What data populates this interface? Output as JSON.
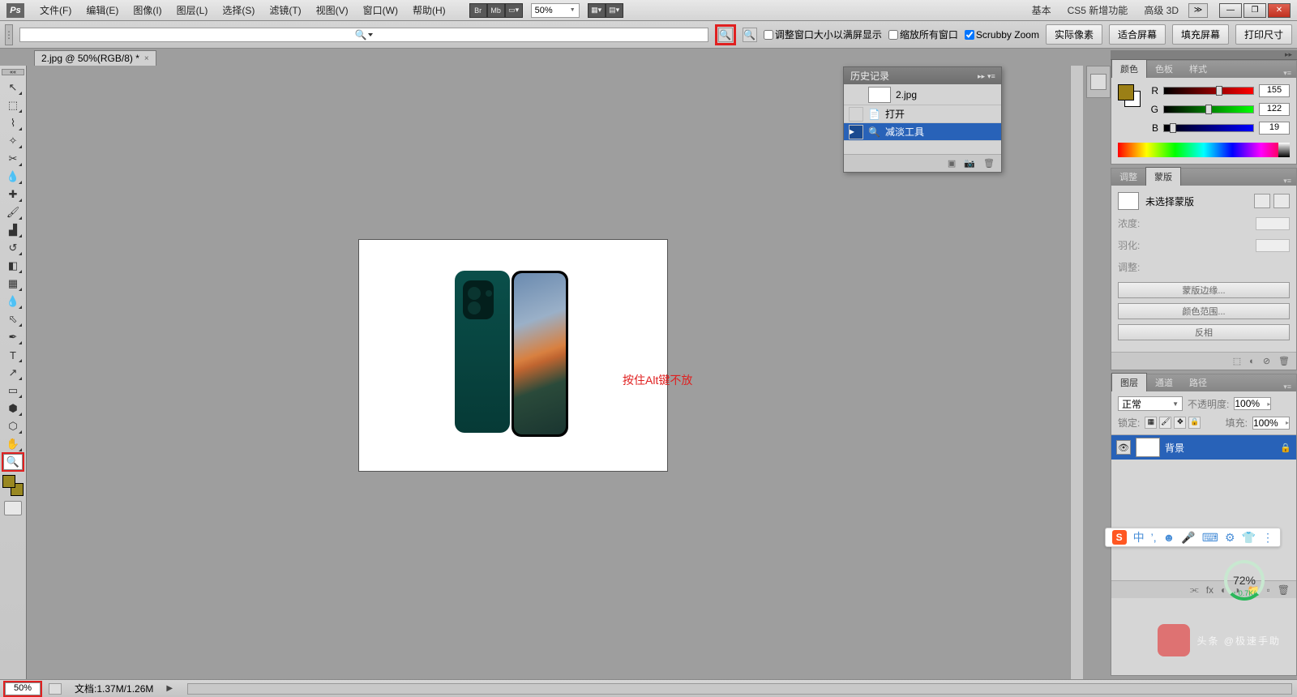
{
  "menu": {
    "items": [
      "文件(F)",
      "编辑(E)",
      "图像(I)",
      "图层(L)",
      "选择(S)",
      "滤镜(T)",
      "视图(V)",
      "窗口(W)",
      "帮助(H)"
    ],
    "zoom": "50%",
    "links": [
      "基本",
      "CS5 新增功能",
      "高级 3D"
    ]
  },
  "options": {
    "chk1": "调整窗口大小以满屏显示",
    "chk2": "缩放所有窗口",
    "chk3": "Scrubby Zoom",
    "btns": [
      "实际像素",
      "适合屏幕",
      "填充屏幕",
      "打印尺寸"
    ]
  },
  "doc": {
    "tab": "2.jpg @ 50%(RGB/8) *"
  },
  "annotation": "按住Alt键不放",
  "history": {
    "title": "历史记录",
    "file": "2.jpg",
    "items": [
      "打开",
      "减淡工具"
    ]
  },
  "color": {
    "tabs": [
      "颜色",
      "色板",
      "样式"
    ],
    "r": "155",
    "g": "122",
    "b": "19"
  },
  "mask": {
    "tabs": [
      "调整",
      "蒙版"
    ],
    "none": "未选择蒙版",
    "density": "浓度:",
    "feather": "羽化:",
    "adjust": "调整:",
    "btns": [
      "蒙版边缘...",
      "颜色范围...",
      "反相"
    ]
  },
  "layers": {
    "tabs": [
      "图层",
      "通道",
      "路径"
    ],
    "mode": "正常",
    "opacity_l": "不透明度:",
    "opacity": "100%",
    "lock_l": "锁定:",
    "fill_l": "填充:",
    "fill": "100%",
    "bg": "背景"
  },
  "status": {
    "zoom": "50%",
    "doc": "文档:1.37M/1.26M"
  },
  "ime": {
    "items": [
      "中",
      "’,",
      "☻",
      "🎤",
      "⌨",
      "⚙",
      "👕",
      "⋮"
    ]
  },
  "progress": {
    "pct": "72%",
    "speed": "↑ 0.7K/s"
  },
  "watermark": "头条 @极速手助"
}
